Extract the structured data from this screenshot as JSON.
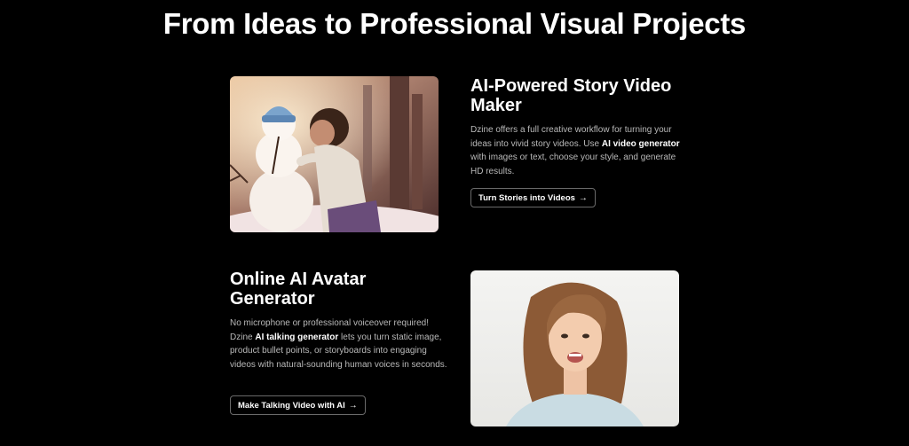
{
  "page": {
    "title": "From Ideas to Professional Visual Projects"
  },
  "story_section": {
    "title": "AI-Powered Story Video Maker",
    "desc_part1": "Dzine offers a full creative workflow for turning your ideas into vivid story videos. Use ",
    "desc_bold": "AI video generator",
    "desc_part2": " with images or text, choose your style, and generate HD results.",
    "cta_label": "Turn Stories into Videos",
    "cta_icon": "arrow-right-icon",
    "media_alt": "Animated girl hugging a snowman in a snowy forest"
  },
  "avatar_section": {
    "title": "Online AI Avatar Generator",
    "desc_part1": "No microphone or professional voiceover required! Dzine ",
    "desc_bold": "AI talking generator",
    "desc_part2": " lets you turn static image, product bullet points, or storyboards into engaging videos with natural-sounding human voices in seconds.",
    "cta_label": "Make Talking Video with AI",
    "cta_icon": "arrow-right-icon",
    "media_alt": "Smiling woman with wavy hair speaking"
  },
  "colors": {
    "background": "#000000",
    "text": "#ffffff",
    "muted_text": "#b9b9b9",
    "button_border": "#6a6a6a"
  }
}
